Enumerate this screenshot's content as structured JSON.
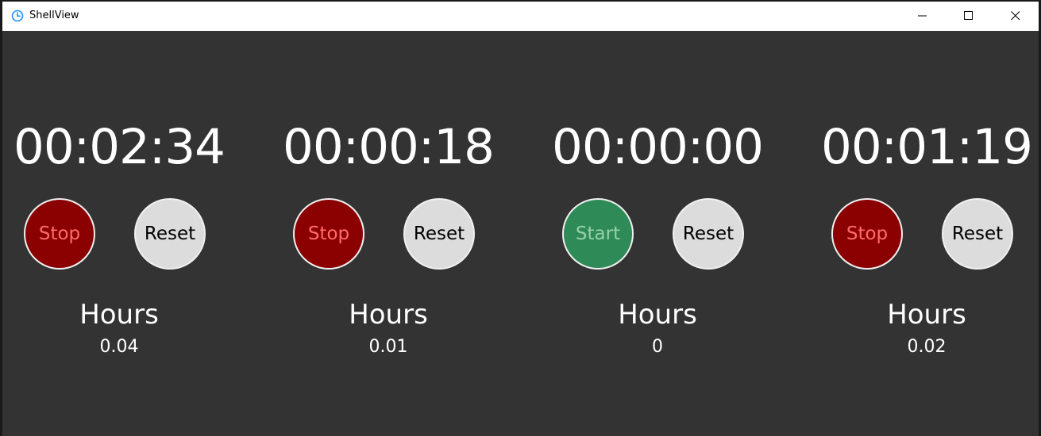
{
  "window": {
    "title": "ShellView",
    "icon": "clock-icon",
    "controls": [
      "minimize-icon",
      "maximize-icon",
      "close-icon"
    ]
  },
  "colors": {
    "background": "#333333",
    "stop": "#8b0000",
    "stop_text": "#ff6b6b",
    "start": "#2e8b57",
    "start_text": "#98d0a8",
    "reset": "#dcdcdc"
  },
  "timers": [
    {
      "time": "00:02:34",
      "action_label": "Stop",
      "action_state": "stop",
      "reset_label": "Reset",
      "hours_label": "Hours",
      "hours_value": "0.04"
    },
    {
      "time": "00:00:18",
      "action_label": "Stop",
      "action_state": "stop",
      "reset_label": "Reset",
      "hours_label": "Hours",
      "hours_value": "0.01"
    },
    {
      "time": "00:00:00",
      "action_label": "Start",
      "action_state": "start",
      "reset_label": "Reset",
      "hours_label": "Hours",
      "hours_value": "0"
    },
    {
      "time": "00:01:19",
      "action_label": "Stop",
      "action_state": "stop",
      "reset_label": "Reset",
      "hours_label": "Hours",
      "hours_value": "0.02"
    }
  ]
}
